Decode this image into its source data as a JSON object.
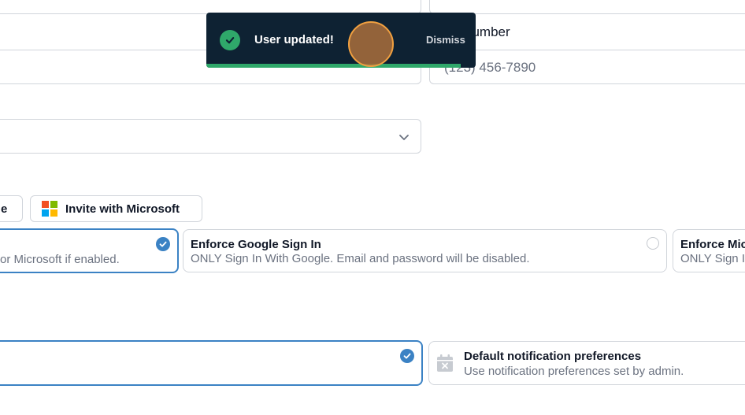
{
  "toast": {
    "message": "User updated!",
    "dismiss_label": "Dismiss",
    "colors": {
      "background": "#0e2233",
      "success": "#2fa86a"
    }
  },
  "phone_field": {
    "label": "number",
    "placeholder": "(123) 456-7890"
  },
  "invite": {
    "google_button_label": "e",
    "microsoft_button_label": "Invite with Microsoft"
  },
  "sign_in_options": [
    {
      "title": "",
      "description": "or Microsoft if enabled.",
      "selected": true
    },
    {
      "title": "Enforce Google Sign In",
      "description": "ONLY Sign In With Google. Email and password will be disabled.",
      "selected": false
    },
    {
      "title": "Enforce Mic",
      "description": "ONLY Sign I",
      "selected": false
    }
  ],
  "notification_options": [
    {
      "title": "",
      "description": "",
      "selected": true
    },
    {
      "title": "Default notification preferences",
      "description": "Use notification preferences set by admin.",
      "icon": "calendar-x-icon"
    }
  ],
  "colors": {
    "accent": "#3b82c4",
    "border": "#d1d5db"
  }
}
